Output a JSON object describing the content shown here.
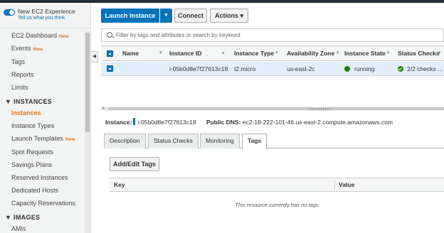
{
  "sidebar": {
    "experience_title": "New EC2 Experience",
    "experience_link": "Tell us what you think",
    "items": [
      {
        "label": "EC2 Dashboard",
        "badge": "New"
      },
      {
        "label": "Events",
        "badge": "New"
      },
      {
        "label": "Tags"
      },
      {
        "label": "Reports"
      },
      {
        "label": "Limits"
      }
    ],
    "instances_section": "INSTANCES",
    "instances_items": [
      {
        "label": "Instances",
        "active": true
      },
      {
        "label": "Instance Types"
      },
      {
        "label": "Launch Templates",
        "badge": "New"
      },
      {
        "label": "Spot Requests"
      },
      {
        "label": "Savings Plans"
      },
      {
        "label": "Reserved Instances"
      },
      {
        "label": "Dedicated Hosts"
      },
      {
        "label": "Capacity Reservations"
      }
    ],
    "images_section": "IMAGES",
    "images_items": [
      {
        "label": "AMIs"
      }
    ]
  },
  "toolbar": {
    "launch_label": "Launch Instance",
    "launch_dropdown_icon": "▾",
    "connect_label": "Connect",
    "actions_label": "Actions ▾"
  },
  "search": {
    "placeholder": "Filter by tags and attributes or search by keyword"
  },
  "table": {
    "headers": [
      "Name",
      "Instance ID",
      "Instance Type",
      "Availability Zone",
      "Instance State",
      "Status Checks"
    ],
    "row": {
      "name": "",
      "instance_id": "i-05b0d8e7f27613c18",
      "instance_type": "t2.micro",
      "availability_zone": "us-east-2c",
      "instance_state": "running",
      "status_checks": "2/2 checks ..."
    }
  },
  "details": {
    "instance_label": "Instance:",
    "instance_id": "i-05b0d8e7f27613c18",
    "dns_label": "Public DNS:",
    "dns_value": "ec2-18-222-101-46.us-east-2.compute.amazonaws.com",
    "tabs": [
      "Description",
      "Status Checks",
      "Monitoring",
      "Tags"
    ],
    "active_tab": "Tags",
    "add_tags_label": "Add/Edit Tags",
    "tags_headers": [
      "Key",
      "Value"
    ],
    "empty_text": "This resource currently has no tags"
  },
  "colors": {
    "accent": "#0073bb",
    "new_badge": "#ec7211",
    "running": "#1d8102"
  }
}
